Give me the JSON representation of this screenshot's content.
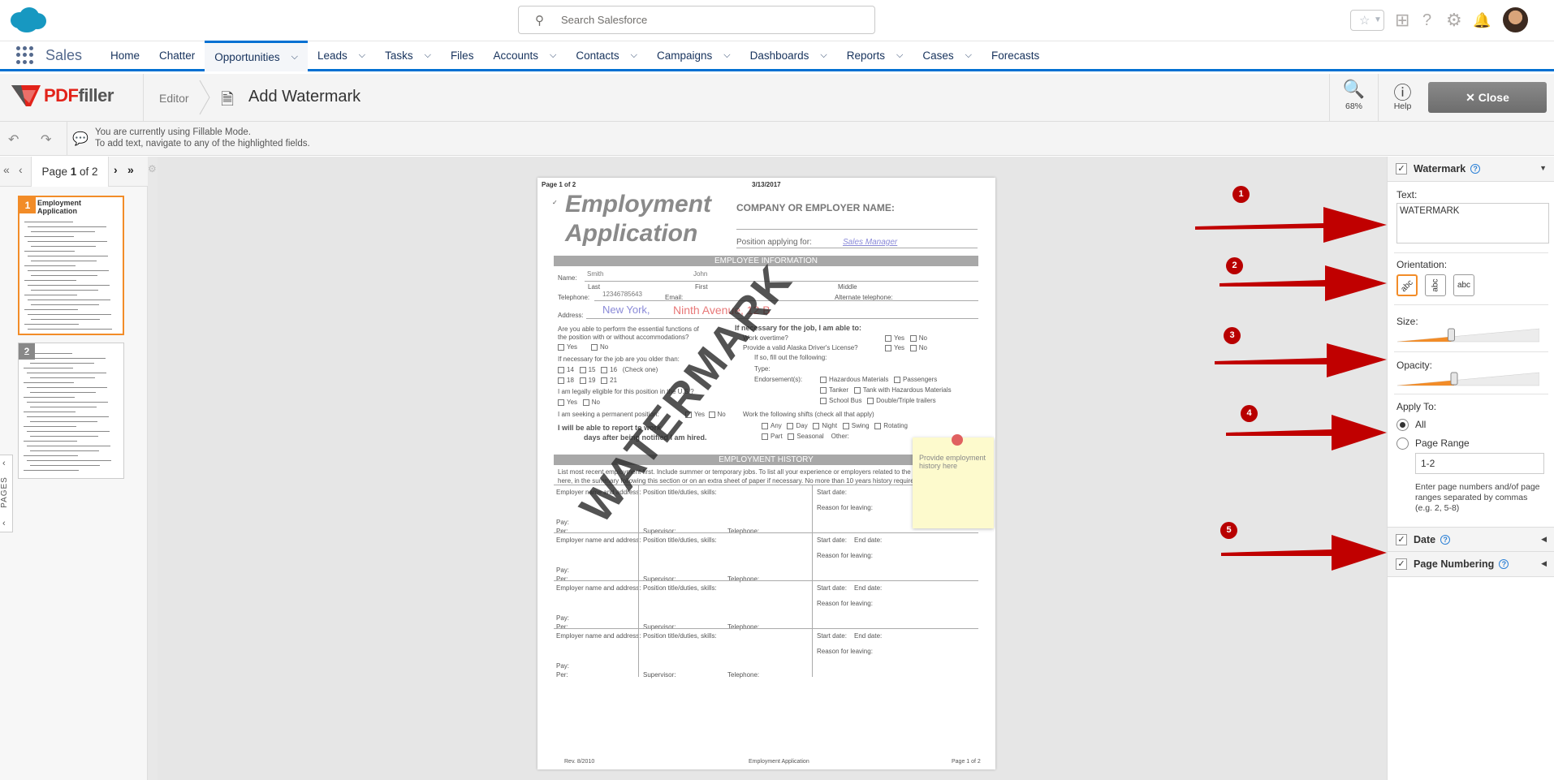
{
  "salesforce": {
    "search_placeholder": "Search Salesforce",
    "app_name": "Sales",
    "nav": [
      {
        "label": "Home",
        "dropdown": false
      },
      {
        "label": "Chatter",
        "dropdown": false
      },
      {
        "label": "Opportunities",
        "dropdown": true,
        "active": true
      },
      {
        "label": "Leads",
        "dropdown": true
      },
      {
        "label": "Tasks",
        "dropdown": true
      },
      {
        "label": "Files",
        "dropdown": false
      },
      {
        "label": "Accounts",
        "dropdown": true
      },
      {
        "label": "Contacts",
        "dropdown": true
      },
      {
        "label": "Campaigns",
        "dropdown": true
      },
      {
        "label": "Dashboards",
        "dropdown": true
      },
      {
        "label": "Reports",
        "dropdown": true
      },
      {
        "label": "Cases",
        "dropdown": true
      },
      {
        "label": "Forecasts",
        "dropdown": false
      }
    ],
    "accent_color": "#0070d2"
  },
  "pdffiller": {
    "logo_pdf": "PDF",
    "logo_filler": "filler",
    "breadcrumb_editor": "Editor",
    "page_title": "Add Watermark",
    "zoom_label": "68%",
    "help_label": "Help",
    "close_label": "Close",
    "info_line1": "You are currently using Fillable Mode.",
    "info_line2": "To add text, navigate to any of the highlighted fields.",
    "pager_prefix": "Page",
    "pager_current": "1",
    "pager_suffix": "of 2",
    "pages_tab": "PAGES",
    "thumb_1": "1",
    "thumb_2": "2",
    "brand_color": "#e2231a",
    "highlight_color": "#f28c28"
  },
  "document": {
    "page_header": "Page 1 of 2",
    "date": "3/13/2017",
    "title_line1": "Employment",
    "title_line2": "Application",
    "company_label": "COMPANY OR EMPLOYER NAME:",
    "position_label": "Position applying for:",
    "position_value": "Sales Manager",
    "section_employee": "EMPLOYEE INFORMATION",
    "name_label": "Name:",
    "last_value": "Smith",
    "first_value": "John",
    "last_label": "Last",
    "first_label": "First",
    "middle_label": "Middle",
    "telephone_label": "Telephone:",
    "telephone_value": "12346785643",
    "email_label": "Email:",
    "alt_tel_label": "Alternate telephone:",
    "address_label": "Address:",
    "city_value": "New York,",
    "street_value": "Ninth Avenue, 12 B",
    "q_essential": "Are you able to perform the essential functions of",
    "q_essential2": "the position with or without accommodations?",
    "yes": "Yes",
    "no": "No",
    "q_age": "If necessary for the job are you older than:",
    "q_legal": "I am legally eligible for this position in the U.S.?",
    "q_permanent": "I am seeking a permanent position:",
    "q_report": "I will be able to report to work",
    "q_report2": "days after being notified I am hired.",
    "q_able_to": "If necessary for the job, I am able to:",
    "work_overtime": "Work overtime?",
    "alaska": "Provide a valid Alaska Driver's License?",
    "if_so": "If so, fill out the following:",
    "type_label": "Type:",
    "endorsements": "Endorsement(s):",
    "work_shifts": "Work the following shifts (check all that apply)",
    "any": "Any",
    "day": "Day",
    "night": "Night",
    "swing": "Swing",
    "rotating": "Rotating",
    "other": "Other:",
    "section_history": "EMPLOYMENT HISTORY",
    "history_text": "List most recent employment first. Include summer or temporary jobs. To list all your experience or employers related to the position,",
    "history_text2": "here, in the summary following this section or on an extra sheet of paper if necessary. No more than 10 years history required.",
    "emp_name_addr": "Employer name and address:",
    "position_duties": "Position title/duties, skills:",
    "start_date": "Start date:",
    "end_date": "End date:",
    "reason_leaving": "Reason for leaving:",
    "pay": "Pay:",
    "per": "Per:",
    "supervisor": "Supervisor:",
    "telephone": "Telephone:",
    "footer_left": "Rev. 8/2010",
    "footer_mid": "Employment Application",
    "footer_right": "Page 1 of 2",
    "watermark_text": "WATERMARK",
    "sticky_text": "Provide employment history here"
  },
  "callouts": [
    "1",
    "2",
    "3",
    "4",
    "5"
  ],
  "panel": {
    "watermark_title": "Watermark",
    "text_label": "Text:",
    "text_value": "WATERMARK",
    "orientation_label": "Orientation:",
    "orient_opts": [
      "abc",
      "abc",
      "abc"
    ],
    "size_label": "Size:",
    "size_value": 0.38,
    "opacity_label": "Opacity:",
    "opacity_value": 0.4,
    "apply_label": "Apply To:",
    "apply_all": "All",
    "apply_range": "Page Range",
    "range_value": "1-2",
    "range_hint": "Enter page numbers and/of page ranges separated by commas (e.g. 2, 5-8)",
    "date_title": "Date",
    "numbering_title": "Page Numbering"
  }
}
